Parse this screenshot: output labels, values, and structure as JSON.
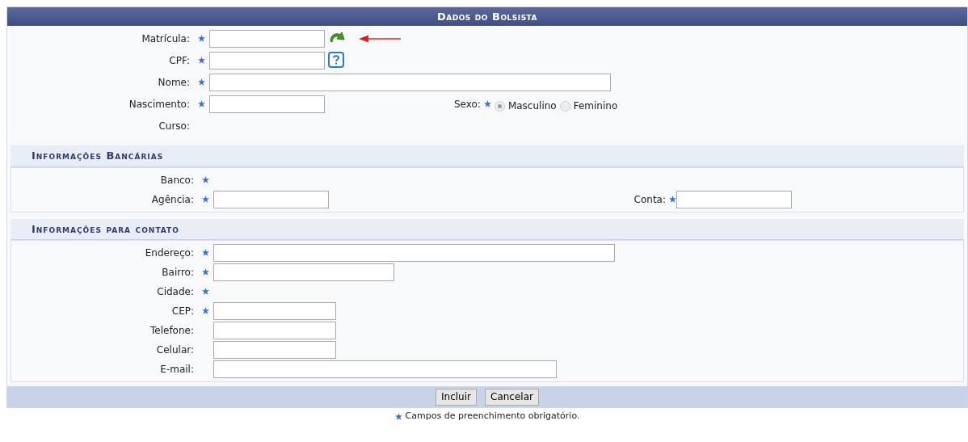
{
  "title": "Dados do Bolsista",
  "main_fields": [
    {
      "label": "Matrícula:",
      "required": true,
      "kind": "short",
      "refresh_button": true
    },
    {
      "label": "CPF:",
      "required": true,
      "kind": "short",
      "help_button": true
    },
    {
      "label": "Nome:",
      "required": true,
      "kind": "long"
    },
    {
      "label": "Nascimento:",
      "required": true,
      "kind": "short"
    },
    {
      "label": "Curso:",
      "required": false,
      "kind": "text"
    }
  ],
  "sexo": {
    "label": "Sexo:",
    "required": true,
    "options": [
      {
        "label": "Masculino",
        "selected": true
      },
      {
        "label": "Feminino",
        "selected": false
      }
    ]
  },
  "sections": [
    {
      "title": "Informações Bancárias",
      "fields": [
        {
          "label": "Banco:",
          "required": true,
          "kind": "text"
        },
        {
          "label": "Agência:",
          "required": true,
          "kind": "short",
          "pair": {
            "label": "Conta:",
            "required": true
          }
        }
      ]
    },
    {
      "title": "Informações para contato",
      "fields": [
        {
          "label": "Endereço:",
          "required": true,
          "kind": "long"
        },
        {
          "label": "Bairro:",
          "required": true,
          "kind": "medium"
        },
        {
          "label": "Cidade:",
          "required": true,
          "kind": "text"
        },
        {
          "label": "CEP:",
          "required": true,
          "kind": "cep"
        },
        {
          "label": "Telefone:",
          "required": false,
          "kind": "cep"
        },
        {
          "label": "Celular:",
          "required": false,
          "kind": "cep"
        },
        {
          "label": "E-mail:",
          "required": false,
          "kind": "email"
        }
      ]
    }
  ],
  "buttons": [
    "Incluir",
    "Cancelar"
  ],
  "note": "Campos de preenchimento obrigatório."
}
